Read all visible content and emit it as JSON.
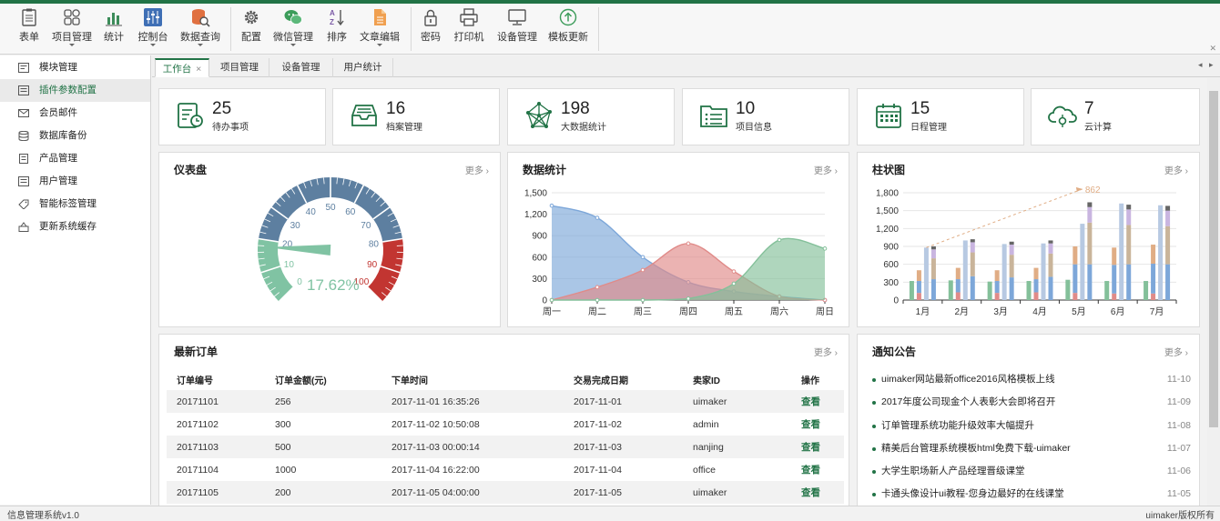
{
  "ribbon": {
    "buttons": [
      {
        "label": "表单",
        "icon": "form-icon",
        "dropdown": false
      },
      {
        "label": "项目管理",
        "icon": "grid-icon",
        "dropdown": true
      },
      {
        "label": "统计",
        "icon": "bar-chart-icon",
        "dropdown": false
      },
      {
        "label": "控制台",
        "icon": "sliders-icon",
        "dropdown": true
      },
      {
        "label": "数据查询",
        "icon": "database-search-icon",
        "dropdown": true
      },
      {
        "label": "配置",
        "icon": "gear-icon",
        "dropdown": false
      },
      {
        "label": "微信管理",
        "icon": "wechat-icon",
        "dropdown": true
      },
      {
        "label": "排序",
        "icon": "sort-az-icon",
        "dropdown": false
      },
      {
        "label": "文章编辑",
        "icon": "document-icon",
        "dropdown": true
      },
      {
        "label": "密码",
        "icon": "lock-icon",
        "dropdown": false
      },
      {
        "label": "打印机",
        "icon": "printer-icon",
        "dropdown": false
      },
      {
        "label": "设备管理",
        "icon": "monitor-icon",
        "dropdown": false
      },
      {
        "label": "模板更新",
        "icon": "upload-circle-icon",
        "dropdown": false
      }
    ],
    "collapse_glyph": "✕"
  },
  "sidebar": {
    "items": [
      {
        "label": "模块管理",
        "icon": "module-icon",
        "active": false
      },
      {
        "label": "插件参数配置",
        "icon": "plugin-icon",
        "active": true
      },
      {
        "label": "会员邮件",
        "icon": "mail-icon",
        "active": false
      },
      {
        "label": "数据库备份",
        "icon": "database-icon",
        "active": false
      },
      {
        "label": "产品管理",
        "icon": "product-icon",
        "active": false
      },
      {
        "label": "用户管理",
        "icon": "user-icon",
        "active": false
      },
      {
        "label": "智能标签管理",
        "icon": "tag-icon",
        "active": false
      },
      {
        "label": "更新系统缓存",
        "icon": "cache-icon",
        "active": false
      }
    ]
  },
  "tabs": [
    {
      "label": "工作台",
      "active": true,
      "closable": true,
      "close_glyph": "×"
    },
    {
      "label": "项目管理",
      "active": false
    },
    {
      "label": "设备管理",
      "active": false
    },
    {
      "label": "用户统计",
      "active": false
    }
  ],
  "tab_nav": {
    "prev": "◂",
    "next": "▸"
  },
  "stats": [
    {
      "value": "25",
      "label": "待办事项",
      "icon": "todo-clock-icon"
    },
    {
      "value": "16",
      "label": "档案管理",
      "icon": "inbox-icon"
    },
    {
      "value": "198",
      "label": "大数据统计",
      "icon": "network-icon"
    },
    {
      "value": "10",
      "label": "项目信息",
      "icon": "folder-list-icon"
    },
    {
      "value": "15",
      "label": "日程管理",
      "icon": "calendar-icon"
    },
    {
      "value": "7",
      "label": "云计算",
      "icon": "cloud-icon"
    }
  ],
  "more_label": "更多 ›",
  "gauge": {
    "title": "仪表盘",
    "percent_label": "17.62%",
    "value": 17.62,
    "ticks": [
      "0",
      "10",
      "20",
      "30",
      "40",
      "50",
      "60",
      "70",
      "80",
      "90",
      "100"
    ],
    "colors": {
      "low": "#80c3a3",
      "mid": "#5d7fa0",
      "high": "#c23531",
      "needle": "#80c3a3"
    }
  },
  "area_chart": {
    "title": "数据统计",
    "chart_data": {
      "type": "area",
      "categories": [
        "周一",
        "周二",
        "周三",
        "周四",
        "周五",
        "周六",
        "周日"
      ],
      "ylim": [
        0,
        1500
      ],
      "yticks": [
        "0",
        "300",
        "600",
        "900",
        "1,200",
        "1,500"
      ],
      "series": [
        {
          "values": [
            1320,
            1150,
            600,
            250,
            120,
            50,
            0
          ],
          "color": "#7da7d9"
        },
        {
          "values": [
            0,
            180,
            420,
            790,
            400,
            50,
            0
          ],
          "color": "#e08b89"
        },
        {
          "values": [
            0,
            0,
            0,
            20,
            230,
            840,
            720
          ],
          "color": "#84c09a"
        }
      ]
    }
  },
  "bar_chart": {
    "title": "柱状图",
    "chart_data": {
      "type": "bar",
      "categories": [
        "1月",
        "2月",
        "3月",
        "4月",
        "5月",
        "6月",
        "7月"
      ],
      "ylim": [
        0,
        1800
      ],
      "yticks": [
        "0",
        "300",
        "600",
        "900",
        "1,200",
        "1,500",
        "1,800"
      ],
      "groups": [
        [
          {
            "total": 320,
            "parts": [
              {
                "v": 320,
                "c": "#84c09a"
              }
            ]
          },
          {
            "total": 500,
            "parts": [
              {
                "v": 120,
                "c": "#e08b89"
              },
              {
                "v": 200,
                "c": "#7da7d9"
              },
              {
                "v": 180,
                "c": "#e0ad85"
              }
            ]
          },
          {
            "total": 880,
            "parts": [
              {
                "v": 880,
                "c": "#b7c9e2"
              }
            ]
          },
          {
            "total": 900,
            "parts": [
              {
                "v": 350,
                "c": "#7da7d9"
              },
              {
                "v": 350,
                "c": "#c9b49a"
              },
              {
                "v": 150,
                "c": "#c9b5e0"
              },
              {
                "v": 50,
                "c": "#666"
              }
            ]
          }
        ],
        [
          {
            "total": 330,
            "parts": [
              {
                "v": 330,
                "c": "#84c09a"
              }
            ]
          },
          {
            "total": 540,
            "parts": [
              {
                "v": 130,
                "c": "#e08b89"
              },
              {
                "v": 220,
                "c": "#7da7d9"
              },
              {
                "v": 190,
                "c": "#e0ad85"
              }
            ]
          },
          {
            "total": 1000,
            "parts": [
              {
                "v": 1000,
                "c": "#b7c9e2"
              }
            ]
          },
          {
            "total": 1020,
            "parts": [
              {
                "v": 400,
                "c": "#7da7d9"
              },
              {
                "v": 400,
                "c": "#c9b49a"
              },
              {
                "v": 170,
                "c": "#c9b5e0"
              },
              {
                "v": 50,
                "c": "#666"
              }
            ]
          }
        ],
        [
          {
            "total": 310,
            "parts": [
              {
                "v": 310,
                "c": "#84c09a"
              }
            ]
          },
          {
            "total": 500,
            "parts": [
              {
                "v": 120,
                "c": "#e08b89"
              },
              {
                "v": 200,
                "c": "#7da7d9"
              },
              {
                "v": 180,
                "c": "#e0ad85"
              }
            ]
          },
          {
            "total": 940,
            "parts": [
              {
                "v": 940,
                "c": "#b7c9e2"
              }
            ]
          },
          {
            "total": 980,
            "parts": [
              {
                "v": 380,
                "c": "#7da7d9"
              },
              {
                "v": 380,
                "c": "#c9b49a"
              },
              {
                "v": 170,
                "c": "#c9b5e0"
              },
              {
                "v": 50,
                "c": "#666"
              }
            ]
          }
        ],
        [
          {
            "total": 320,
            "parts": [
              {
                "v": 320,
                "c": "#84c09a"
              }
            ]
          },
          {
            "total": 540,
            "parts": [
              {
                "v": 130,
                "c": "#e08b89"
              },
              {
                "v": 220,
                "c": "#7da7d9"
              },
              {
                "v": 190,
                "c": "#e0ad85"
              }
            ]
          },
          {
            "total": 950,
            "parts": [
              {
                "v": 950,
                "c": "#b7c9e2"
              }
            ]
          },
          {
            "total": 1000,
            "parts": [
              {
                "v": 390,
                "c": "#7da7d9"
              },
              {
                "v": 390,
                "c": "#c9b49a"
              },
              {
                "v": 170,
                "c": "#c9b5e0"
              },
              {
                "v": 50,
                "c": "#666"
              }
            ]
          }
        ],
        [
          {
            "total": 340,
            "parts": [
              {
                "v": 340,
                "c": "#84c09a"
              }
            ]
          },
          {
            "total": 900,
            "parts": [
              {
                "v": 120,
                "c": "#e08b89"
              },
              {
                "v": 480,
                "c": "#7da7d9"
              },
              {
                "v": 300,
                "c": "#e0ad85"
              }
            ]
          },
          {
            "total": 1280,
            "parts": [
              {
                "v": 1280,
                "c": "#b7c9e2"
              }
            ]
          },
          {
            "total": 1640,
            "parts": [
              {
                "v": 600,
                "c": "#7da7d9"
              },
              {
                "v": 700,
                "c": "#c9b49a"
              },
              {
                "v": 260,
                "c": "#c9b5e0"
              },
              {
                "v": 80,
                "c": "#666"
              }
            ]
          }
        ],
        [
          {
            "total": 320,
            "parts": [
              {
                "v": 320,
                "c": "#84c09a"
              }
            ]
          },
          {
            "total": 880,
            "parts": [
              {
                "v": 110,
                "c": "#e08b89"
              },
              {
                "v": 480,
                "c": "#7da7d9"
              },
              {
                "v": 290,
                "c": "#e0ad85"
              }
            ]
          },
          {
            "total": 1620,
            "parts": [
              {
                "v": 1620,
                "c": "#b7c9e2"
              }
            ]
          },
          {
            "total": 1600,
            "parts": [
              {
                "v": 600,
                "c": "#7da7d9"
              },
              {
                "v": 660,
                "c": "#c9b49a"
              },
              {
                "v": 260,
                "c": "#c9b5e0"
              },
              {
                "v": 80,
                "c": "#666"
              }
            ]
          }
        ],
        [
          {
            "total": 320,
            "parts": [
              {
                "v": 320,
                "c": "#84c09a"
              }
            ]
          },
          {
            "total": 930,
            "parts": [
              {
                "v": 110,
                "c": "#e08b89"
              },
              {
                "v": 500,
                "c": "#7da7d9"
              },
              {
                "v": 320,
                "c": "#e0ad85"
              }
            ]
          },
          {
            "total": 1590,
            "parts": [
              {
                "v": 1590,
                "c": "#b7c9e2"
              }
            ]
          },
          {
            "total": 1580,
            "parts": [
              {
                "v": 600,
                "c": "#7da7d9"
              },
              {
                "v": 640,
                "c": "#c9b49a"
              },
              {
                "v": 260,
                "c": "#c9b5e0"
              },
              {
                "v": 80,
                "c": "#666"
              }
            ]
          }
        ]
      ],
      "markline": {
        "from": {
          "category": "1月",
          "value": 880
        },
        "to": {
          "category": "5月",
          "value": 1862
        },
        "label": "862",
        "color": "#e0ad85"
      }
    }
  },
  "orders": {
    "title": "最新订单",
    "columns": [
      "订单编号",
      "订单金额(元)",
      "下单时间",
      "交易完成日期",
      "卖家ID",
      "操作"
    ],
    "rows": [
      [
        "20171101",
        "256",
        "2017-11-01 16:35:26",
        "2017-11-01",
        "uimaker",
        "查看"
      ],
      [
        "20171102",
        "300",
        "2017-11-02 10:50:08",
        "2017-11-02",
        "admin",
        "查看"
      ],
      [
        "20171103",
        "500",
        "2017-11-03 00:00:14",
        "2017-11-03",
        "nanjing",
        "查看"
      ],
      [
        "20171104",
        "1000",
        "2017-11-04 16:22:00",
        "2017-11-04",
        "office",
        "查看"
      ],
      [
        "20171105",
        "200",
        "2017-11-05 04:00:00",
        "2017-11-05",
        "uimaker",
        "查看"
      ]
    ]
  },
  "notices": {
    "title": "通知公告",
    "items": [
      {
        "text": "uimaker网站最新office2016风格模板上线",
        "date": "11-10"
      },
      {
        "text": "2017年度公司现金个人表彰大会即将召开",
        "date": "11-09"
      },
      {
        "text": "订单管理系统功能升级效率大幅提升",
        "date": "11-08"
      },
      {
        "text": "精美后台管理系统模板html免费下载-uimaker",
        "date": "11-07"
      },
      {
        "text": "大学生职场新人产品经理晋级课堂",
        "date": "11-06"
      },
      {
        "text": "卡通头像设计ui教程-您身边最好的在线课堂",
        "date": "11-05"
      }
    ]
  },
  "status": {
    "left": "信息管理系统v1.0",
    "right": "uimaker版权所有"
  },
  "theme": {
    "accent": "#217346"
  }
}
